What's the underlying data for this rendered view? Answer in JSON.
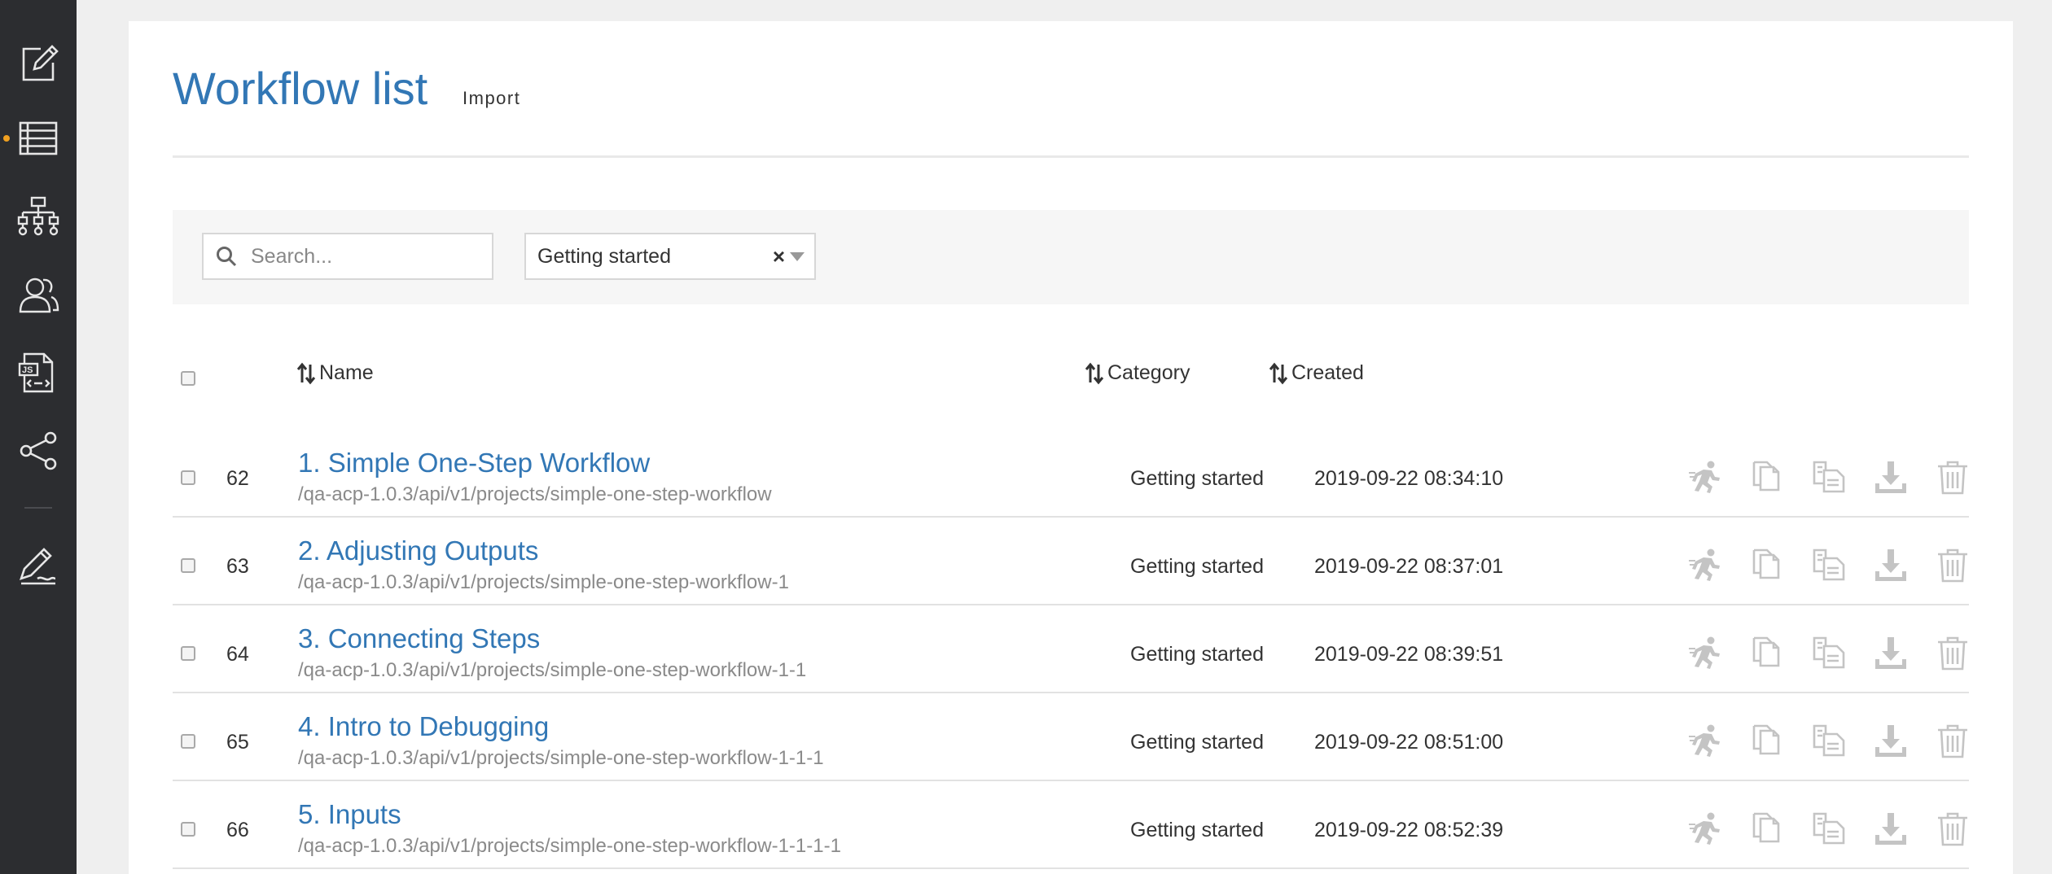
{
  "sidebar": {
    "items": [
      {
        "icon": "edit-icon"
      },
      {
        "icon": "list-icon",
        "active": true
      },
      {
        "icon": "hierarchy-icon"
      },
      {
        "icon": "users-icon"
      },
      {
        "icon": "js-file-icon"
      },
      {
        "icon": "share-icon"
      },
      {
        "icon": "signature-icon"
      }
    ],
    "accent_color": "#f0a020"
  },
  "header": {
    "title": "Workflow list",
    "import_label": "Import"
  },
  "filters": {
    "search_placeholder": "Search...",
    "category_selected": "Getting started",
    "clear_glyph": "×"
  },
  "table": {
    "columns": {
      "name": "Name",
      "category": "Category",
      "created": "Created"
    },
    "rows": [
      {
        "id": "62",
        "name": "1. Simple One-Step Workflow",
        "path": "/qa-acp-1.0.3/api/v1/projects/simple-one-step-workflow",
        "category": "Getting started",
        "created": "2019-09-22 08:34:10"
      },
      {
        "id": "63",
        "name": "2. Adjusting Outputs",
        "path": "/qa-acp-1.0.3/api/v1/projects/simple-one-step-workflow-1",
        "category": "Getting started",
        "created": "2019-09-22 08:37:01"
      },
      {
        "id": "64",
        "name": "3. Connecting Steps",
        "path": "/qa-acp-1.0.3/api/v1/projects/simple-one-step-workflow-1-1",
        "category": "Getting started",
        "created": "2019-09-22 08:39:51"
      },
      {
        "id": "65",
        "name": "4. Intro to Debugging",
        "path": "/qa-acp-1.0.3/api/v1/projects/simple-one-step-workflow-1-1-1",
        "category": "Getting started",
        "created": "2019-09-22 08:51:00"
      },
      {
        "id": "66",
        "name": "5. Inputs",
        "path": "/qa-acp-1.0.3/api/v1/projects/simple-one-step-workflow-1-1-1-1",
        "category": "Getting started",
        "created": "2019-09-22 08:52:39"
      }
    ],
    "row_actions": [
      "run-icon",
      "duplicate-icon",
      "copy-to-icon",
      "download-icon",
      "trash-icon"
    ]
  },
  "colors": {
    "link": "#3277b5",
    "sidebar_bg": "#2c2d30",
    "action_icon": "#c4c4c4"
  }
}
